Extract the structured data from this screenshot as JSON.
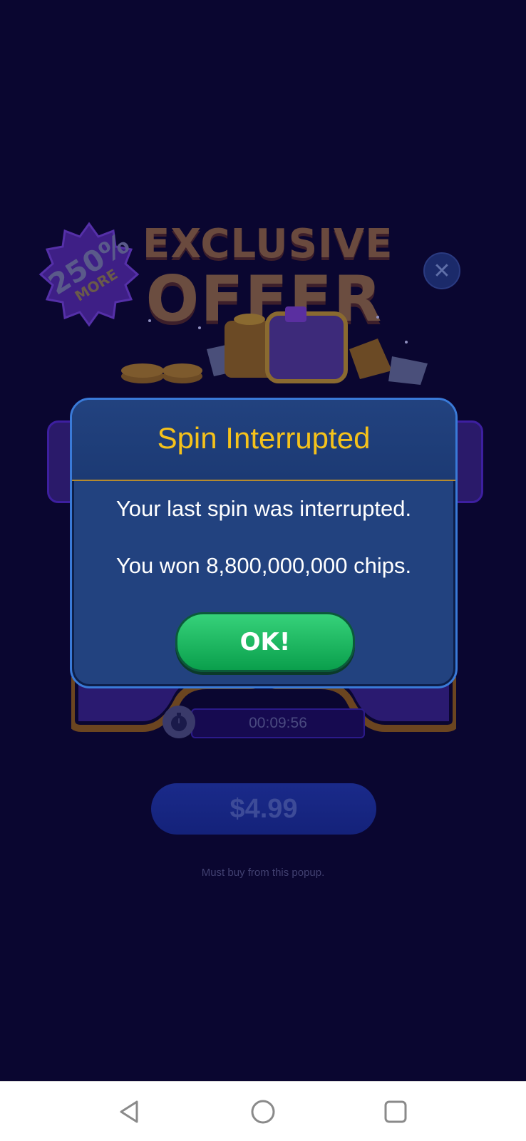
{
  "offer": {
    "title_line1": "EXCLUSIVE",
    "title_line2": "OFFER",
    "badge_percent": "250%",
    "badge_more": "MORE",
    "close_glyph": "✕",
    "timer": "00:09:56",
    "price": "$4.99",
    "note": "Must buy from this popup."
  },
  "dialog": {
    "title": "Spin Interrupted",
    "line1": "Your last spin was interrupted.",
    "line2": "You won 8,800,000,000 chips.",
    "ok_label": "OK!"
  },
  "navbar": {
    "icons": [
      "back-icon",
      "home-icon",
      "recents-icon"
    ]
  },
  "colors": {
    "background": "#0a0630",
    "dialog_title": "#f5c21b",
    "ok_button": "#1bbf63",
    "dialog_body": "#22427f"
  }
}
